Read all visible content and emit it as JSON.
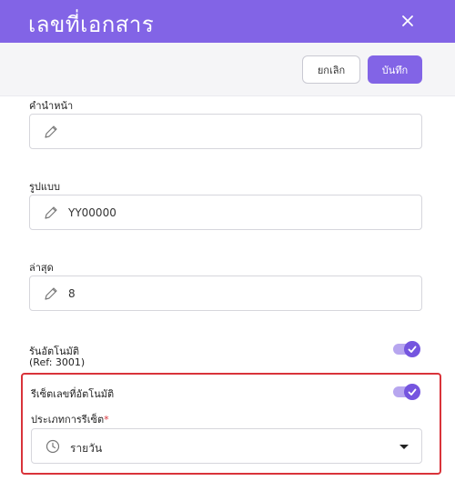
{
  "header": {
    "title": "เลขที่เอกสาร",
    "close_icon": "close-icon"
  },
  "toolbar": {
    "cancel_label": "ยกเลิก",
    "save_label": "บันทึก"
  },
  "fields": {
    "prefix": {
      "label": "คำนำหน้า",
      "value": ""
    },
    "format": {
      "label": "รูปแบบ",
      "value": "YY00000"
    },
    "latest": {
      "label": "ล่าสุด",
      "value": "8"
    }
  },
  "auto_run": {
    "label": "รันอัตโนมัติ",
    "ref": "(Ref: 3001)",
    "enabled": true
  },
  "auto_reset": {
    "label": "รีเซ็ตเลขที่อัตโนมัติ",
    "enabled": true
  },
  "reset_type": {
    "label": "ประเภทการรีเซ็ต",
    "required_mark": "*",
    "value": "รายวัน"
  },
  "colors": {
    "accent": "#8264e6",
    "highlight": "#d9333a"
  }
}
